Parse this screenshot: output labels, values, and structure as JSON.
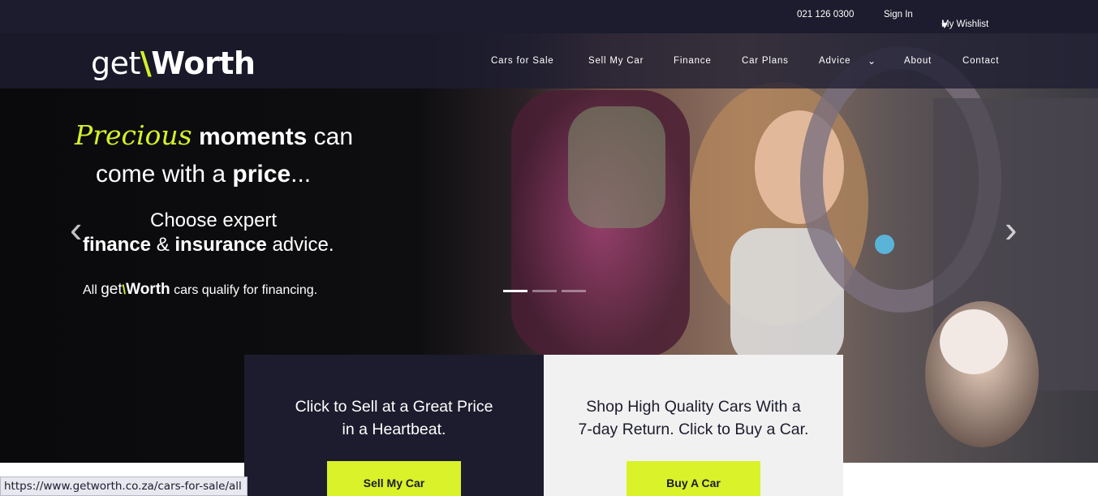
{
  "topbar": {
    "phone": "021 126 0300",
    "sign_in": "Sign In",
    "wishlist": "My Wishlist"
  },
  "logo": {
    "get": "get",
    "slash": "\\",
    "worth": "Worth"
  },
  "nav": {
    "items": [
      "Cars for Sale",
      "Sell My Car",
      "Finance",
      "Car Plans",
      "Advice",
      "About",
      "Contact"
    ]
  },
  "hero": {
    "script_word": "Precious",
    "line1_bold": "moments",
    "line1_rest": "can",
    "line2_pre": "come with a",
    "line2_bold": "price",
    "line2_end": "...",
    "sub1": "Choose expert",
    "sub2_bold1": "finance",
    "sub2_mid": "&",
    "sub2_bold2": "insurance",
    "sub2_end": "advice.",
    "sub3_pre": "All",
    "sub3_get": "get",
    "sub3_slash": "\\",
    "sub3_worth": "Worth",
    "sub3_end": "cars qualify for financing.",
    "slides_total": 3,
    "slide_active": 1
  },
  "cards": {
    "sell": {
      "text_line1": "Click to Sell at a Great Price",
      "text_line2": "in a Heartbeat.",
      "button": "Sell My Car"
    },
    "buy": {
      "text_line1": "Shop High Quality Cars With a",
      "text_line2": "7-day Return. Click to Buy a Car.",
      "button": "Buy A Car"
    }
  },
  "status_url": "https://www.getworth.co.za/cars-for-sale/all",
  "colors": {
    "brand_dark": "#1c1c2e",
    "accent_lime": "#d9f22a"
  },
  "icons": {
    "wishlist": "heart-icon",
    "prev": "chevron-left-icon",
    "next": "chevron-right-icon",
    "advice_dropdown": "chevron-down-icon"
  }
}
